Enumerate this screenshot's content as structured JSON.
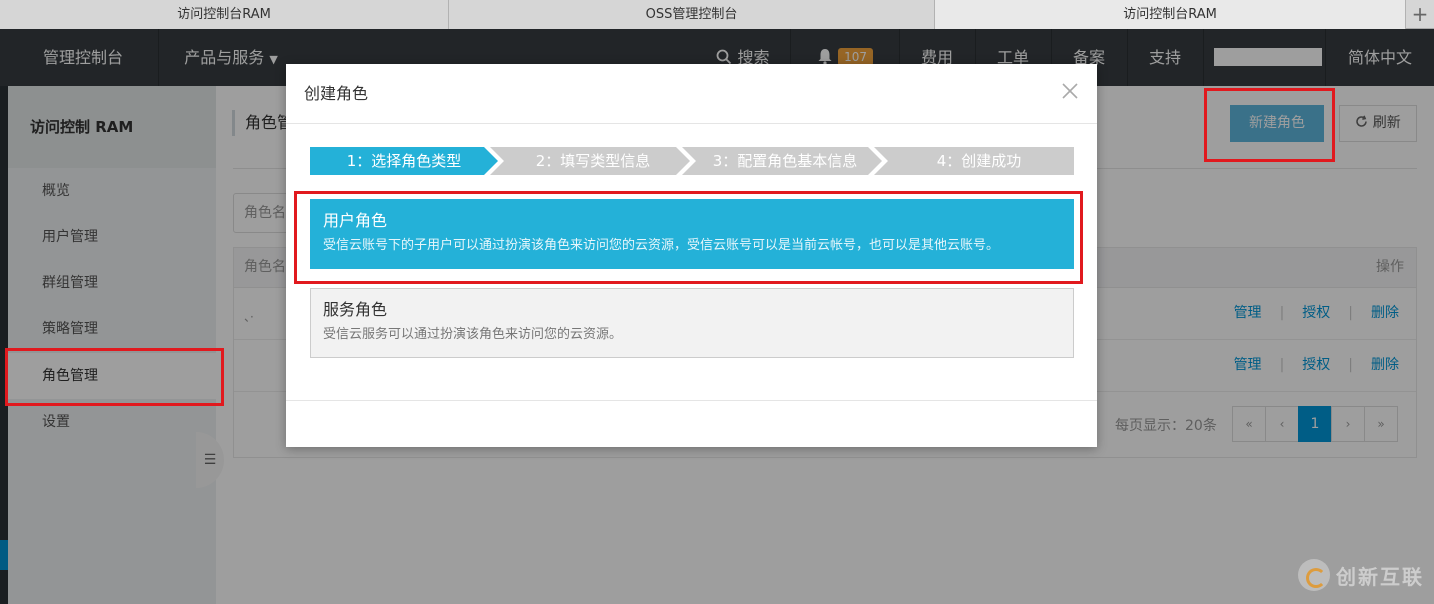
{
  "browser": {
    "tabs": [
      "访问控制台RAM",
      "OSS管理控制台",
      "访问控制台RAM"
    ],
    "new_tab_icon": "+"
  },
  "topnav": {
    "home": "管理控制台",
    "products": "产品与服务",
    "search": "搜索",
    "notifications": "107",
    "items": [
      "费用",
      "工单",
      "备案",
      "支持"
    ],
    "language": "简体中文"
  },
  "sidebar": {
    "title": "访问控制 RAM",
    "items": [
      "概览",
      "用户管理",
      "群组管理",
      "策略管理",
      "角色管理",
      "设置"
    ],
    "active_index": 4
  },
  "main": {
    "title": "角色管",
    "new_button": "新建角色",
    "refresh_button": "刷新",
    "search_placeholder": "角色名",
    "table_header": {
      "name": "角色名",
      "actions": "操作"
    },
    "rows": [
      {
        "name": "、·",
        "actions": [
          "管理",
          "授权",
          "删除"
        ]
      },
      {
        "name": "",
        "actions": [
          "管理",
          "授权",
          "删除"
        ]
      }
    ],
    "page_size_text": "每页显示：20条",
    "pager": {
      "first": "«",
      "prev": "‹",
      "current": "1",
      "next": "›",
      "last": "»"
    }
  },
  "modal": {
    "title": "创建角色",
    "steps": [
      "1：选择角色类型",
      "2：填写类型信息",
      "3：配置角色基本信息",
      "4：创建成功"
    ],
    "active_step": 0,
    "options": [
      {
        "title": "用户角色",
        "desc": "受信云账号下的子用户可以通过扮演该角色来访问您的云资源，受信云账号可以是当前云帐号，也可以是其他云账号。",
        "selected": true
      },
      {
        "title": "服务角色",
        "desc": "受信云服务可以通过扮演该角色来访问您的云资源。",
        "selected": false
      }
    ]
  },
  "watermark": {
    "text": "创新互联"
  },
  "colors": {
    "accent": "#24b1d8",
    "step_active": "#24b1d8",
    "step_inactive": "#cccccc",
    "annotation": "#e1191e",
    "topnav_bg": "#373d41",
    "link": "#0097d8"
  }
}
